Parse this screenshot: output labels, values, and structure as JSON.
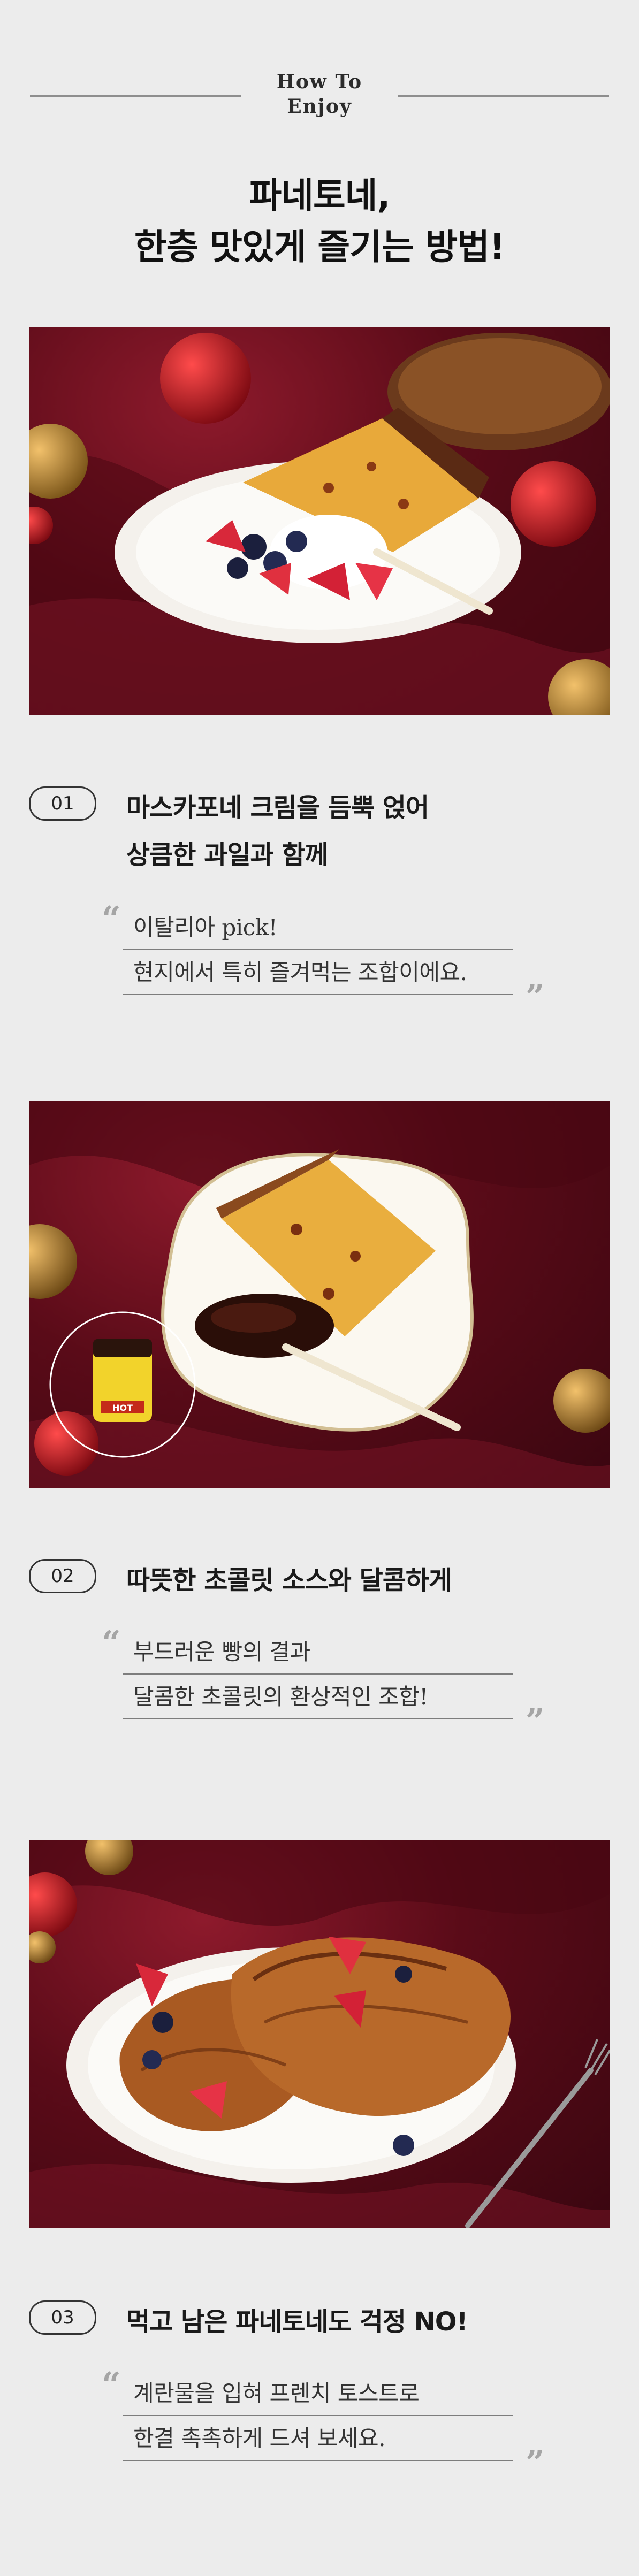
{
  "header": {
    "eyebrow_line1": "How To",
    "eyebrow_line2": "Enjoy",
    "title_line1": "파네토네,",
    "title_line2": "한층 맛있게 즐기는 방법!"
  },
  "steps": [
    {
      "number": "01",
      "title_lines": [
        "마스카포네 크림을 듬뿍 얹어",
        "상큼한 과일과 함께"
      ],
      "quote_lines": [
        "이탈리아 pick!",
        "현지에서 특히 즐겨먹는 조합이에요."
      ]
    },
    {
      "number": "02",
      "title_lines": [
        "따뜻한 초콜릿 소스와 달콤하게"
      ],
      "quote_lines": [
        "부드러운 빵의 결과",
        "달콤한 초콜릿의 환상적인 조합!"
      ]
    },
    {
      "number": "03",
      "title_lines": [
        "먹고 남은 파네토네도 걱정 NO!"
      ],
      "quote_lines": [
        "계란물을 입혀 프렌치 토스트로",
        "한결 촉촉하게 드셔 보세요."
      ]
    }
  ],
  "photos": [
    {
      "icon": "panettone-with-cream-and-berries-photo"
    },
    {
      "icon": "panettone-with-chocolate-sauce-photo"
    },
    {
      "icon": "panettone-french-toast-photo"
    }
  ],
  "colors": {
    "background": "#ececec",
    "velvet": "#6a0d1d",
    "text": "#222222",
    "quote_mark": "#a5a5a5"
  },
  "quote_marks": {
    "open": "“",
    "close": "”"
  },
  "jar_label": "HOT"
}
